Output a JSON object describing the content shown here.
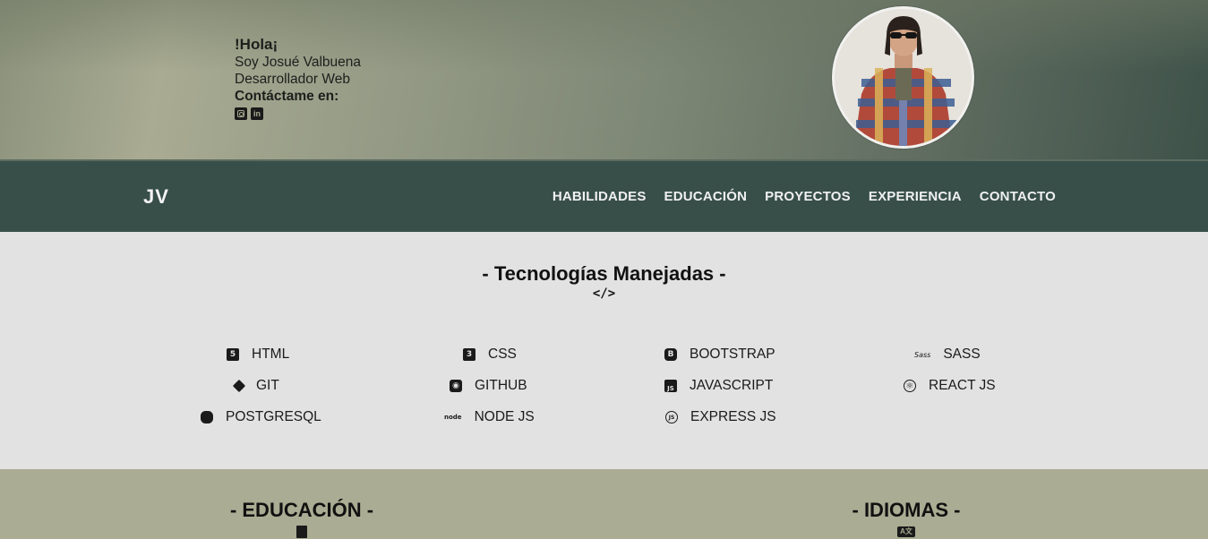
{
  "hero": {
    "greeting": "!Hola¡",
    "intro_line": "Soy Josué Valbuena",
    "role": "Desarrollador Web",
    "contact_label": "Contáctame en:",
    "social": [
      {
        "icon": "instagram-icon"
      },
      {
        "icon": "linkedin-icon",
        "glyph": "in"
      }
    ]
  },
  "nav": {
    "logo": "JV",
    "links": [
      "HABILIDADES",
      "EDUCACIÓN",
      "PROYECTOS",
      "EXPERIENCIA",
      "CONTACTO"
    ]
  },
  "tech": {
    "title": "- Tecnologías Manejadas -",
    "code_glyph": "</>",
    "skills": [
      {
        "label": "HTML",
        "icon": "html5-icon"
      },
      {
        "label": "CSS",
        "icon": "css3-icon"
      },
      {
        "label": "BOOTSTRAP",
        "icon": "bootstrap-icon"
      },
      {
        "label": "SASS",
        "icon": "sass-icon"
      },
      {
        "label": "GIT",
        "icon": "git-icon"
      },
      {
        "label": "GITHUB",
        "icon": "github-icon"
      },
      {
        "label": "JAVASCRIPT",
        "icon": "javascript-icon"
      },
      {
        "label": "REACT JS",
        "icon": "react-icon"
      },
      {
        "label": "POSTGRESQL",
        "icon": "database-icon"
      },
      {
        "label": "NODE JS",
        "icon": "nodejs-icon"
      },
      {
        "label": "EXPRESS JS",
        "icon": "expressjs-icon"
      }
    ]
  },
  "sections": {
    "education_title": "- EDUCACIÓN -",
    "languages_title": "- IDIOMAS -"
  },
  "colors": {
    "nav_bg": "#384f49",
    "tech_bg": "#e2e2e2",
    "bottom_bg": "#aaac93"
  }
}
